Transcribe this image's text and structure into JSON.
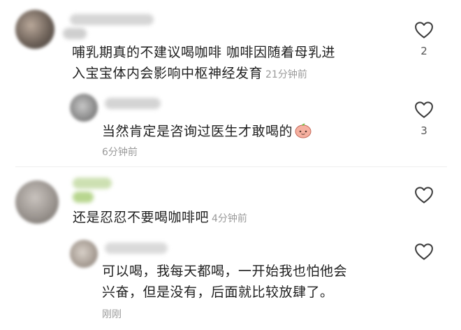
{
  "comments": [
    {
      "text_line1": "哺乳期真的不建议喝咖啡  咖啡因随着母乳进",
      "text_line2": "入宝宝体内会影响中枢神经发育",
      "time": "21分钟前",
      "likes": "2",
      "like_icon": "heart-outline-icon"
    },
    {
      "text": "当然肯定是咨询过医生才敢喝的",
      "emoji": "peach-face-emoji",
      "time": "6分钟前",
      "likes": "3",
      "like_icon": "heart-outline-icon"
    },
    {
      "text": "还是忍忍不要喝咖啡吧",
      "time": "4分钟前",
      "likes": "",
      "like_icon": "heart-outline-icon"
    },
    {
      "text_line1": "可以喝，我每天都喝，一开始我也怕他会",
      "text_line2": "兴奋，但是没有，后面就比较放肆了。",
      "time": "刚刚",
      "likes": "",
      "like_icon": "heart-outline-icon"
    }
  ],
  "colors": {
    "text": "#1f1f1f",
    "time": "#9a9a9a",
    "icon": "#3a3a3a"
  }
}
